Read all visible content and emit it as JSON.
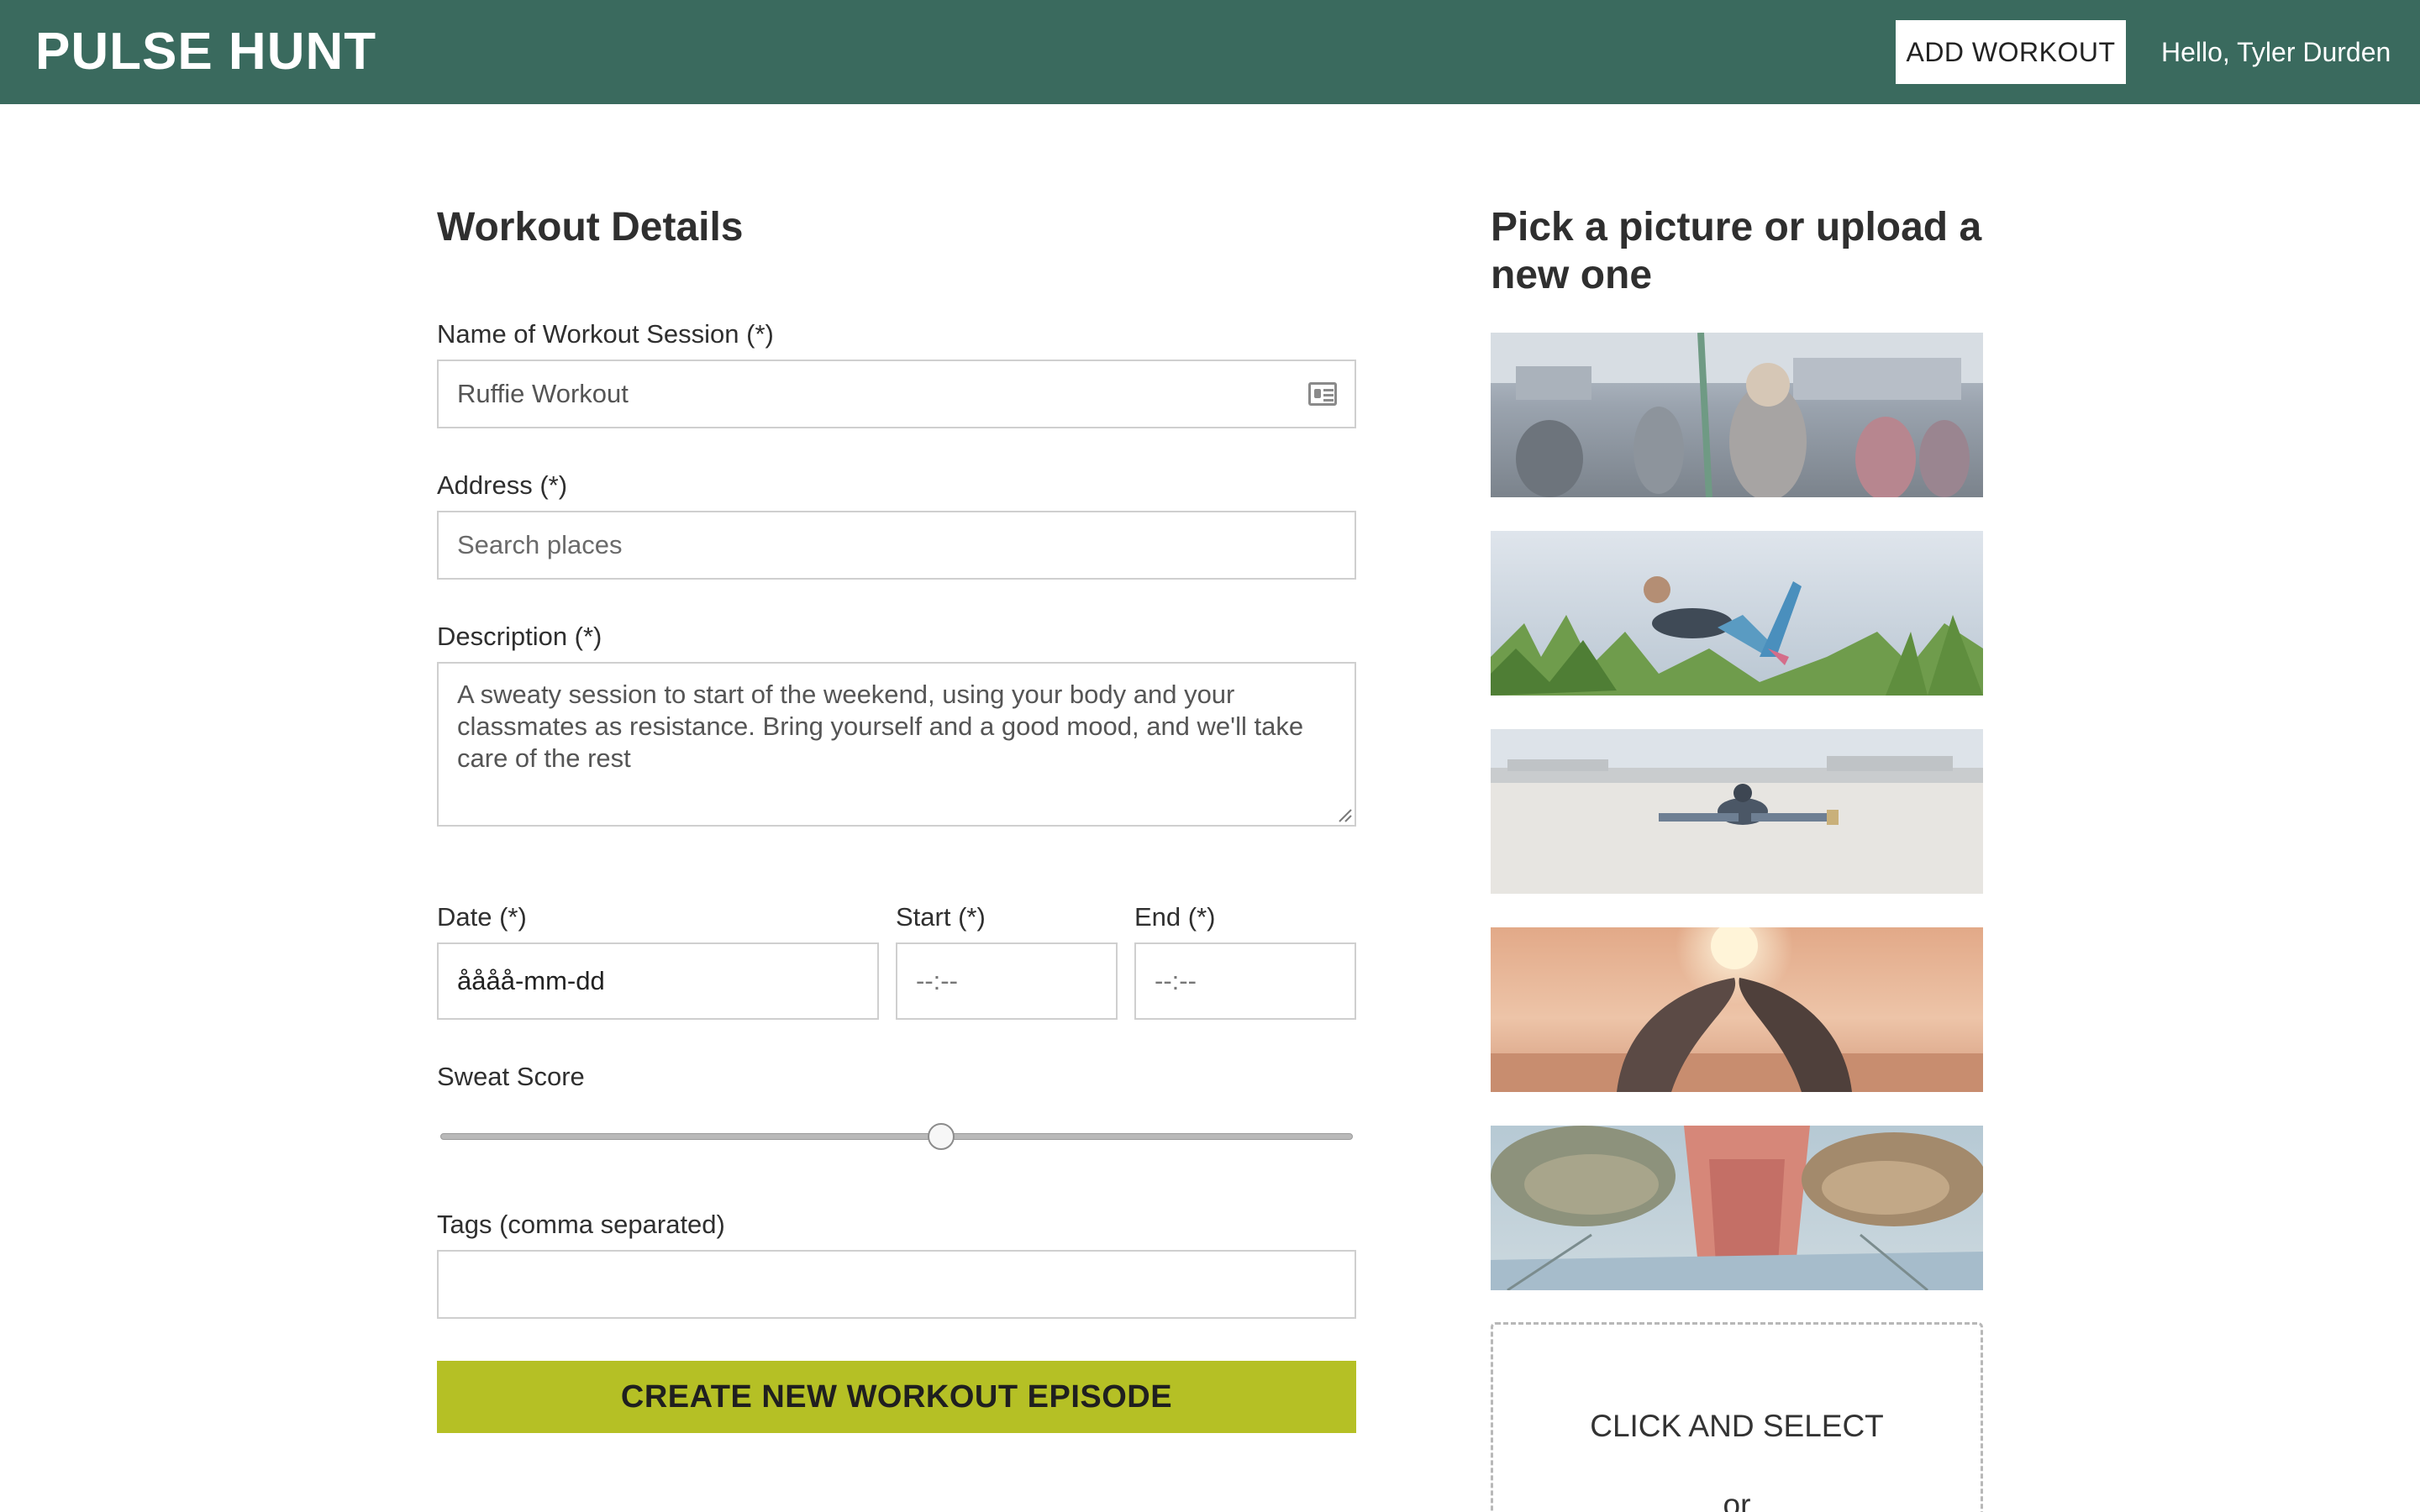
{
  "header": {
    "brand": "PULSE HUNT",
    "add_workout_label": "ADD WORKOUT",
    "greeting": "Hello, Tyler Durden",
    "background_color": "#3a6a5e"
  },
  "form": {
    "title": "Workout Details",
    "name": {
      "label": "Name of Workout Session (*)",
      "value": "Ruffie Workout",
      "icon": "contact-card-icon"
    },
    "address": {
      "label": "Address (*)",
      "placeholder": "Search places",
      "value": ""
    },
    "description": {
      "label": "Description (*)",
      "value": "A sweaty session to start of the weekend, using your body and your classmates as resistance. Bring yourself and a good mood, and we'll take care of the rest"
    },
    "date": {
      "label": "Date (*)",
      "value": "åååå-mm-dd"
    },
    "start": {
      "label": "Start (*)",
      "value": "--:--"
    },
    "end": {
      "label": "End (*)",
      "value": "--:--"
    },
    "sweat_score": {
      "label": "Sweat Score",
      "level_fraction": 0.55
    },
    "tags": {
      "label": "Tags (comma separated)",
      "value": ""
    },
    "submit_label": "CREATE NEW WORKOUT EPISODE",
    "submit_color": "#b5c025"
  },
  "pictures": {
    "title": "Pick a picture or upload a new one",
    "options": [
      {
        "name": "gym-class-photo"
      },
      {
        "name": "outdoor-yoga-stretch-photo"
      },
      {
        "name": "rooftop-stretch-photo"
      },
      {
        "name": "sunset-partner-stretch-photo"
      },
      {
        "name": "running-shoes-photo"
      }
    ],
    "upload_label": "CLICK AND SELECT",
    "upload_or": "or"
  }
}
